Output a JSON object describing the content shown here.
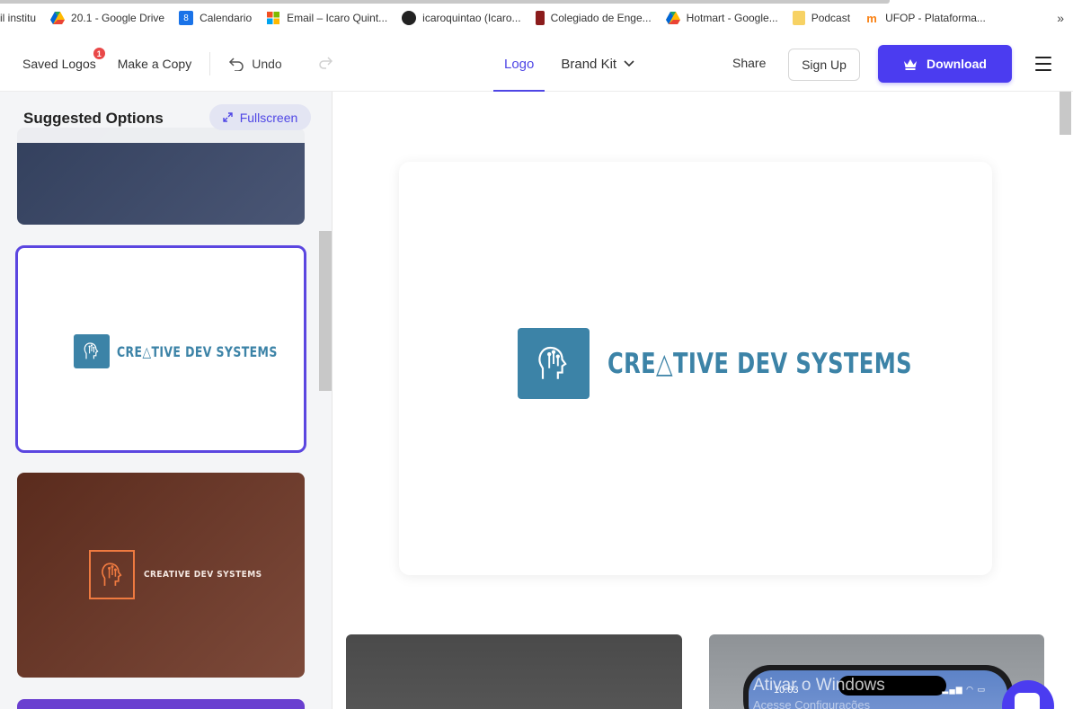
{
  "bookmarks": [
    {
      "label": "il institu",
      "icon": "page-icon",
      "color": "#ffffff"
    },
    {
      "label": "20.1 - Google Drive",
      "icon": "google-drive-icon",
      "color": "#1fa463"
    },
    {
      "label": "Calendario",
      "icon": "calendar-icon",
      "color": "#1a73e8",
      "badge": "8"
    },
    {
      "label": "Email – Icaro Quint...",
      "icon": "microsoft-icon",
      "color": "#f25022"
    },
    {
      "label": "icaroquintao (Icaro...",
      "icon": "github-icon",
      "color": "#222222"
    },
    {
      "label": "Colegiado de Enge...",
      "icon": "bookmark-icon",
      "color": "#8b1c1c"
    },
    {
      "label": "Hotmart - Google...",
      "icon": "google-drive-icon",
      "color": "#1fa463"
    },
    {
      "label": "Podcast",
      "icon": "folder-icon",
      "color": "#f7d264"
    },
    {
      "label": "UFOP - Plataforma...",
      "icon": "moodle-icon",
      "color": "#f98012"
    }
  ],
  "bookmarks_more": "»",
  "header": {
    "saved_logos": "Saved Logos",
    "saved_badge": "1",
    "make_copy": "Make a Copy",
    "undo": "Undo",
    "tabs": [
      {
        "label": "Logo",
        "active": true
      },
      {
        "label": "Brand Kit",
        "active": false
      }
    ],
    "share": "Share",
    "sign_up": "Sign Up",
    "download": "Download"
  },
  "left_panel": {
    "title": "Suggested Options",
    "fullscreen": "Fullscreen",
    "cards": [
      {
        "style": "dark-slate"
      },
      {
        "style": "white",
        "selected": true,
        "text": "CRE△TIVE DEV SYSTEMS"
      },
      {
        "style": "brown",
        "text": "CREATIVE DEV SYSTEMS"
      },
      {
        "style": "purple"
      }
    ]
  },
  "preview": {
    "logo_text": "CRE△TIVE DEV SYSTEMS",
    "brand_color": "#3c83a7"
  },
  "mockups": {
    "phone_time": "10:03",
    "phone_status": "▂▄▆ ◠ ▭"
  },
  "overlay": {
    "watermark_line1": "Ativar o Windows",
    "watermark_line2": "Acesse Configurações"
  },
  "colors": {
    "accent": "#4b3cf0",
    "brand": "#3c83a7",
    "badge": "#e94848"
  }
}
